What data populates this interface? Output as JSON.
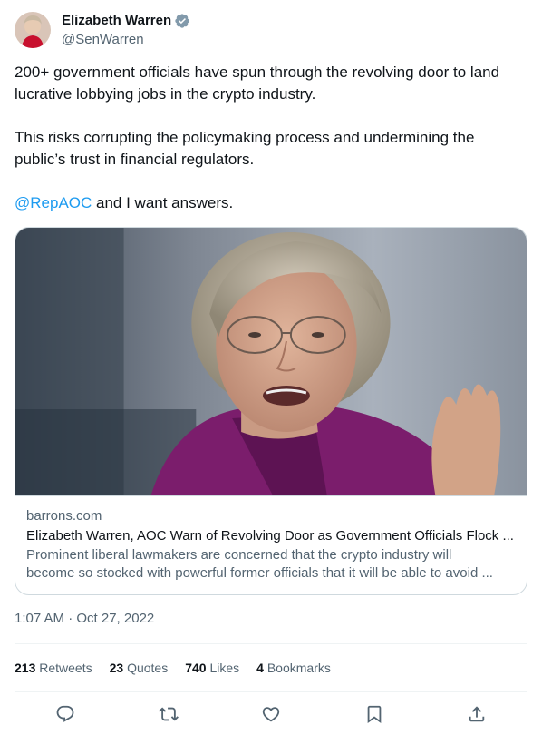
{
  "author": {
    "display_name": "Elizabeth Warren",
    "handle": "@SenWarren",
    "verified": true
  },
  "tweet": {
    "paragraph1": "200+ government officials have spun through the revolving door to land lucrative lobbying jobs in the crypto industry.",
    "paragraph2": "This risks corrupting the policymaking process and undermining the public’s trust in financial regulators.",
    "mention": "@RepAOC",
    "paragraph3_rest": " and I want answers."
  },
  "card": {
    "domain": "barrons.com",
    "title": "Elizabeth Warren, AOC Warn of Revolving Door as Government Officials Flock ...",
    "description_line1": "Prominent liberal lawmakers are concerned that the crypto industry will",
    "description_line2": "become so stocked with powerful former officials that it will be able to avoid ..."
  },
  "timestamp": "1:07 AM · Oct 27, 2022",
  "stats": {
    "retweets_count": "213",
    "retweets_label": "Retweets",
    "quotes_count": "23",
    "quotes_label": "Quotes",
    "likes_count": "740",
    "likes_label": "Likes",
    "bookmarks_count": "4",
    "bookmarks_label": "Bookmarks"
  },
  "actions": [
    "reply-icon",
    "retweet-icon",
    "like-icon",
    "bookmark-icon",
    "share-icon"
  ],
  "colors": {
    "text": "#0f1419",
    "secondary": "#536471",
    "link": "#1d9bf0",
    "border": "#cfd9de",
    "verified": "#829aab"
  }
}
